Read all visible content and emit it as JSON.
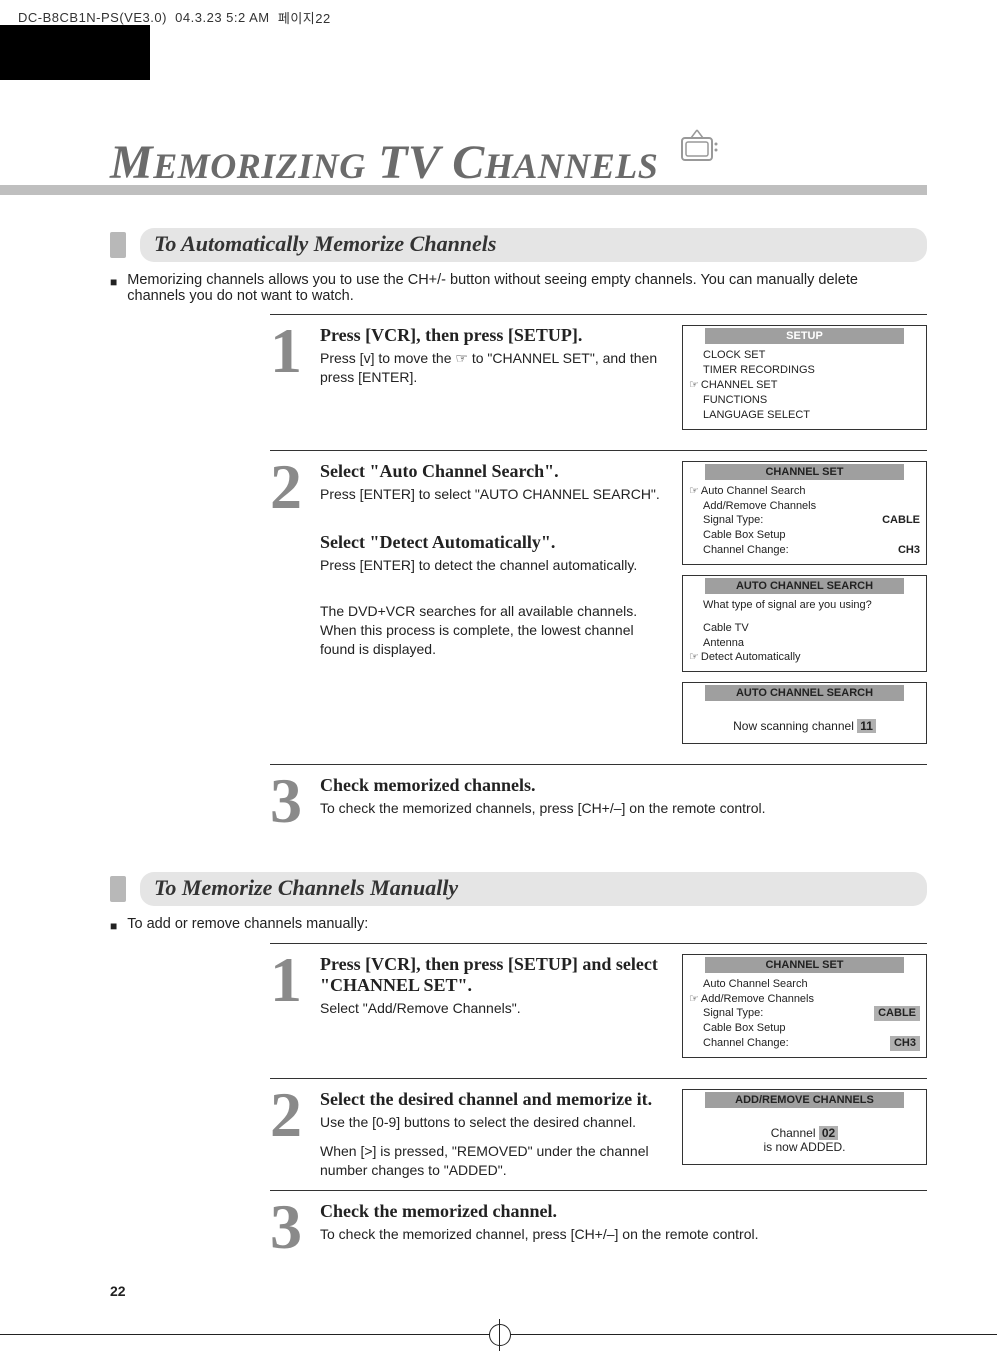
{
  "crop_header": {
    "file": "DC-B8CB1N-PS(VE3.0)",
    "date": "04.3.23 5:2 AM",
    "page": "페이지22"
  },
  "title": {
    "word1_cap": "M",
    "word1_rest": "EMORIZING",
    "word2": "TV",
    "word3_cap": "C",
    "word3_rest": "HANNELS"
  },
  "section1": {
    "heading": "To Automatically Memorize Channels",
    "intro": "Memorizing channels allows you to use the CH+/- button without seeing empty channels. You can manually delete channels you do not want to watch.",
    "steps": [
      {
        "num": "1",
        "title": "Press [VCR], then press [SETUP].",
        "paras": [
          "Press [v] to move the  ☞  to \"CHANNEL SET\", and then press [ENTER]."
        ]
      },
      {
        "num": "2",
        "title": "Select \"Auto Channel Search\".",
        "paras": [
          "Press [ENTER] to select \"AUTO CHANNEL SEARCH\"."
        ],
        "sub": [
          {
            "title": "Select \"Detect Automatically\".",
            "paras": [
              "Press [ENTER] to detect the channel automatically."
            ]
          },
          {
            "paras": [
              "The DVD+VCR searches for all available channels. When this process is complete, the lowest channel found is displayed."
            ]
          }
        ]
      },
      {
        "num": "3",
        "title": "Check memorized channels.",
        "paras": [
          "To check the memorized channels, press [CH+/–] on the remote control."
        ]
      }
    ],
    "osd": {
      "setup": {
        "header": "SETUP",
        "items": [
          "CLOCK SET",
          "TIMER RECORDINGS",
          "CHANNEL SET",
          "FUNCTIONS",
          "LANGUAGE SELECT"
        ],
        "pointer_index": 2
      },
      "channel_set": {
        "header": "CHANNEL SET",
        "rows": [
          {
            "label": "Auto Channel Search"
          },
          {
            "label": "Add/Remove Channels"
          },
          {
            "label": "Signal Type:",
            "value": "CABLE"
          },
          {
            "label": "Cable Box Setup"
          },
          {
            "label": "Channel Change:",
            "value": "CH3"
          }
        ],
        "pointer_index": 0
      },
      "auto_search1": {
        "header": "AUTO CHANNEL SEARCH",
        "question": "What type of signal are you using?",
        "options": [
          "Cable TV",
          "Antenna",
          "Detect Automatically"
        ],
        "pointer_index": 2
      },
      "auto_search2": {
        "header": "AUTO CHANNEL SEARCH",
        "text_pre": "Now scanning channel ",
        "num": "11"
      }
    }
  },
  "section2": {
    "heading": "To Memorize Channels Manually",
    "intro": "To add or remove channels manually:",
    "steps": [
      {
        "num": "1",
        "title": "Press [VCR], then press [SETUP] and select \"CHANNEL SET\".",
        "paras": [
          "Select \"Add/Remove Channels\"."
        ]
      },
      {
        "num": "2",
        "title": "Select the desired channel and memorize it.",
        "paras": [
          "Use the [0-9] buttons to select the desired channel.",
          "When [>] is pressed, \"REMOVED\" under the channel number changes to \"ADDED\"."
        ]
      },
      {
        "num": "3",
        "title": "Check the memorized channel.",
        "paras": [
          "To check the memorized channel, press [CH+/–] on the remote control."
        ]
      }
    ],
    "osd": {
      "channel_set": {
        "header": "CHANNEL SET",
        "rows": [
          {
            "label": "Auto Channel Search"
          },
          {
            "label": "Add/Remove Channels"
          },
          {
            "label": "Signal Type:",
            "value": "CABLE",
            "hi": true
          },
          {
            "label": "Cable Box Setup"
          },
          {
            "label": "Channel Change:",
            "value": "CH3",
            "hi": true
          }
        ],
        "pointer_index": 1
      },
      "add_remove": {
        "header": "ADD/REMOVE CHANNELS",
        "line1_pre": "Channel ",
        "line1_num": "02",
        "line2": "is now ADDED."
      }
    }
  },
  "page_number": "22"
}
